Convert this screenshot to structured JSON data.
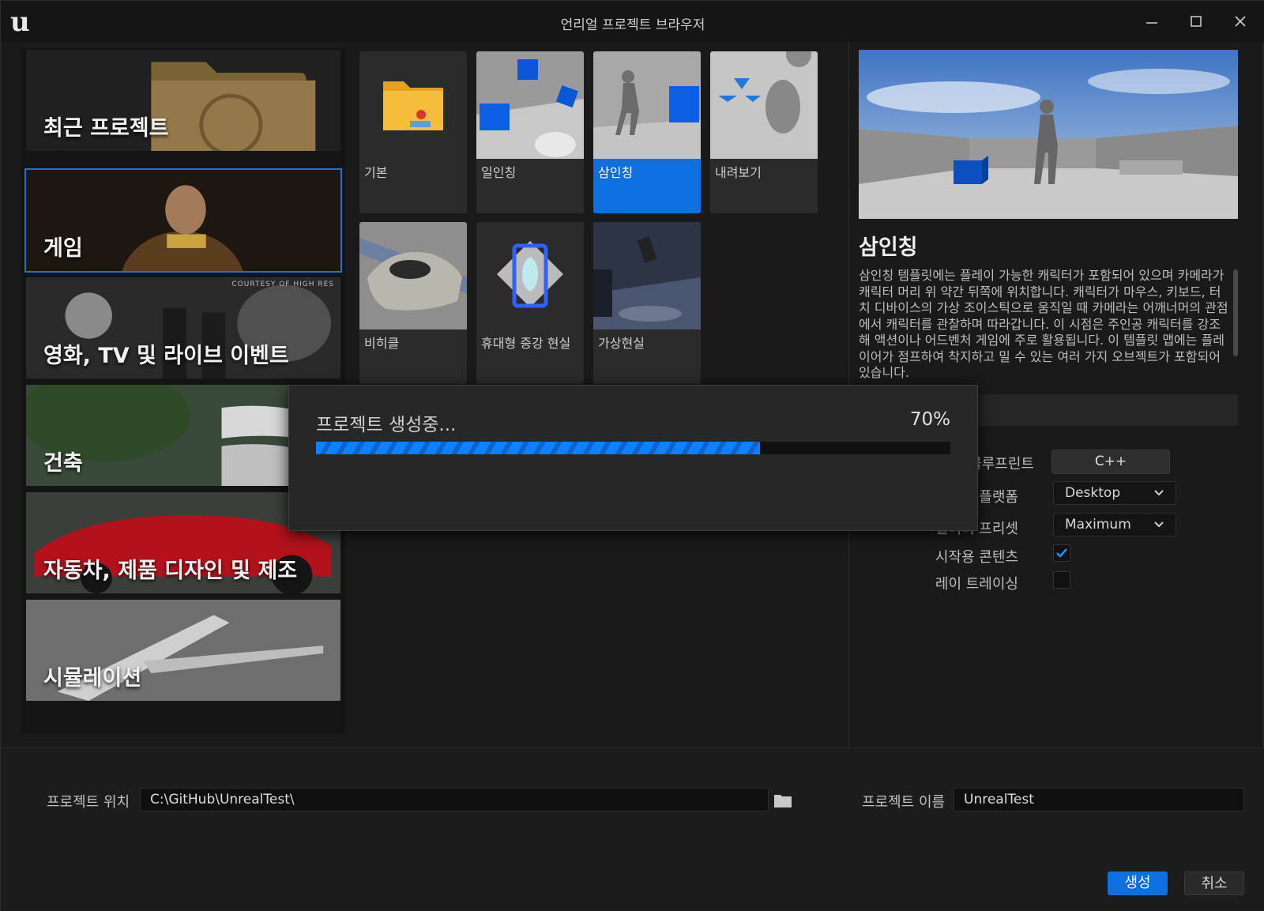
{
  "window": {
    "title": "언리얼 프로젝트 브라우저"
  },
  "categories": [
    {
      "label": "최근 프로젝트",
      "selected": false
    },
    {
      "label": "게임",
      "selected": true
    },
    {
      "label": "영화, TV 및 라이브 이벤트",
      "selected": false,
      "credit": "COURTESY OF HIGH RES"
    },
    {
      "label": "건축",
      "selected": false
    },
    {
      "label": "자동차, 제품 디자인 및 제조",
      "selected": false
    },
    {
      "label": "시뮬레이션",
      "selected": false
    }
  ],
  "templates": [
    {
      "label": "기본",
      "selected": false
    },
    {
      "label": "일인칭",
      "selected": false
    },
    {
      "label": "삼인칭",
      "selected": true
    },
    {
      "label": "내려보기",
      "selected": false
    },
    {
      "label": "비히클",
      "selected": false
    },
    {
      "label": "휴대형 증강 현실",
      "selected": false
    },
    {
      "label": "가상현실",
      "selected": false
    }
  ],
  "details": {
    "title": "삼인칭",
    "description": "삼인칭 템플릿에는 플레이 가능한 캐릭터가 포함되어 있으며 카메라가 캐릭터 머리 위 약간 뒤쪽에 위치합니다. 캐릭터가 마우스, 키보드, 터치 디바이스의 가상 조이스틱으로 움직일 때 카메라는 어깨너머의 관점에서 캐릭터를 관찰하며 따라갑니다. 이 시점은 주인공 캐릭터를 강조해 액션이나 어드벤처 게임에 주로 활용됩니다. 이 템플릿 맵에는 플레이어가 점프하여 착지하고 밀 수 있는 여러 가지 오브젝트가 포함되어 있습니다.",
    "language": {
      "blueprint_label": "블루프린트",
      "cpp_label": "C++"
    },
    "target_platform": {
      "label": "타깃 플랫폼",
      "value": "Desktop"
    },
    "quality_preset": {
      "label": "퀄리티 프리셋",
      "value": "Maximum"
    },
    "starter_content": {
      "label": "시작용 콘텐츠",
      "checked": true
    },
    "ray_tracing": {
      "label": "레이 트레이싱",
      "checked": false
    }
  },
  "bottom": {
    "location_label": "프로젝트 위치",
    "location_value": "C:\\GitHub\\UnrealTest\\",
    "name_label": "프로젝트 이름",
    "name_value": "UnrealTest",
    "create_label": "생성",
    "cancel_label": "취소"
  },
  "progress": {
    "text": "프로젝트 생성중...",
    "percent_label": "70%",
    "value": 0.7
  },
  "colors": {
    "accent": "#0d6fe0",
    "background": "#1a1a1a",
    "panel": "#2b2b2b"
  }
}
